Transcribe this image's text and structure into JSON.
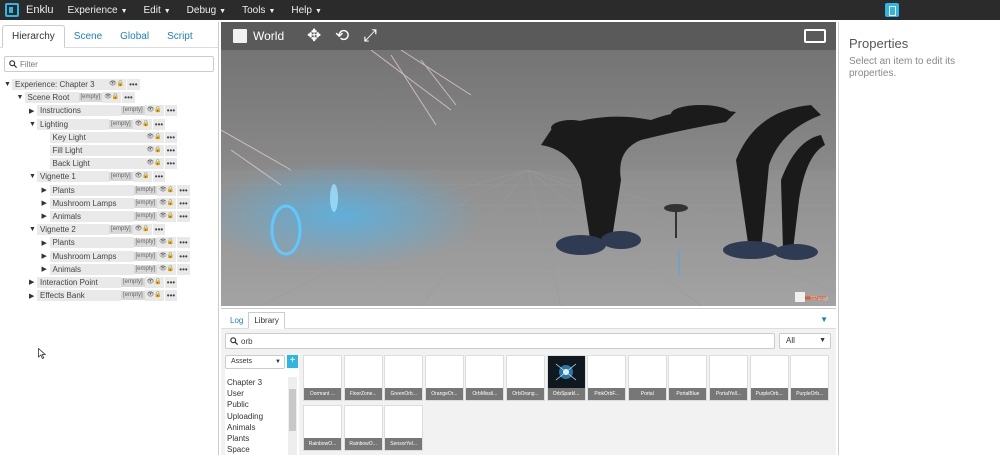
{
  "app": {
    "name": "Enklu"
  },
  "menubar": {
    "items": [
      "Experience",
      "Edit",
      "Debug",
      "Tools",
      "Help"
    ]
  },
  "hierarchy": {
    "tabs": [
      "Hierarchy",
      "Scene",
      "Global",
      "Script"
    ],
    "active_tab": "Hierarchy",
    "filter_placeholder": "Filter",
    "nodes": [
      {
        "label": "Experience: Chapter 3",
        "depth": 0,
        "state": "open",
        "tag": "",
        "eye": true
      },
      {
        "label": "Scene Root",
        "depth": 1,
        "state": "open",
        "tag": "[empty]",
        "eye": true
      },
      {
        "label": "Instructions",
        "depth": 2,
        "state": "closed",
        "tag": "[empty]",
        "eye": true
      },
      {
        "label": "Lighting",
        "depth": 2,
        "state": "open",
        "tag": "[empty]",
        "eye": true
      },
      {
        "label": "Key Light",
        "depth": 3,
        "state": "none",
        "tag": "",
        "eye": true
      },
      {
        "label": "Fill Light",
        "depth": 3,
        "state": "none",
        "tag": "",
        "eye": true
      },
      {
        "label": "Back Light",
        "depth": 3,
        "state": "none",
        "tag": "",
        "eye": true
      },
      {
        "label": "Vignette 1",
        "depth": 2,
        "state": "open",
        "tag": "[empty]",
        "eye": true
      },
      {
        "label": "Plants",
        "depth": 3,
        "state": "closed",
        "tag": "[empty]",
        "eye": true
      },
      {
        "label": "Mushroom Lamps",
        "depth": 3,
        "state": "closed",
        "tag": "[empty]",
        "eye": true
      },
      {
        "label": "Animals",
        "depth": 3,
        "state": "closed",
        "tag": "[empty]",
        "eye": true
      },
      {
        "label": "Vignette 2",
        "depth": 2,
        "state": "open",
        "tag": "[empty]",
        "eye": true
      },
      {
        "label": "Plants",
        "depth": 3,
        "state": "closed",
        "tag": "[empty]",
        "eye": true
      },
      {
        "label": "Mushroom Lamps",
        "depth": 3,
        "state": "closed",
        "tag": "[empty]",
        "eye": true
      },
      {
        "label": "Animals",
        "depth": 3,
        "state": "closed",
        "tag": "[empty]",
        "eye": true
      },
      {
        "label": "Interaction Point",
        "depth": 2,
        "state": "closed",
        "tag": "[empty]",
        "eye": true
      },
      {
        "label": "Effects Bank",
        "depth": 2,
        "state": "closed",
        "tag": "[empty]",
        "eye": true
      }
    ]
  },
  "viewport": {
    "space_label": "World",
    "credit": "©Passp"
  },
  "library": {
    "tabs": [
      "Log",
      "Library"
    ],
    "active_tab": "Library",
    "search_value": "orb",
    "filter_value": "All",
    "source_value": "Assets",
    "categories": [
      "Chapter 3",
      "User",
      "Public",
      "Uploading",
      "Animals",
      "Plants",
      "Space"
    ],
    "assets": [
      {
        "name": "Dormant ...",
        "selected": false
      },
      {
        "name": "FloorZone...",
        "selected": false
      },
      {
        "name": "GreenOrb...",
        "selected": false
      },
      {
        "name": "OrangeOr...",
        "selected": false
      },
      {
        "name": "OrbMissil...",
        "selected": false
      },
      {
        "name": "OrbOrang...",
        "selected": false
      },
      {
        "name": "OrbSparkl...",
        "selected": true
      },
      {
        "name": "PinkOrbF...",
        "selected": false
      },
      {
        "name": "Portal",
        "selected": false
      },
      {
        "name": "PortalBlue",
        "selected": false
      },
      {
        "name": "PortalYell...",
        "selected": false
      },
      {
        "name": "PurpleOrb...",
        "selected": false
      },
      {
        "name": "PurpleOrb...",
        "selected": false
      },
      {
        "name": "RainbowO...",
        "selected": false
      },
      {
        "name": "RainbowO...",
        "selected": false
      },
      {
        "name": "SensorYel...",
        "selected": false
      }
    ]
  },
  "properties": {
    "title": "Properties",
    "message": "Select an item to edit its properties."
  },
  "colors": {
    "accent": "#2fb5e6",
    "menubar": "#2b2b2b",
    "viewport_bg": "#7b7b7b"
  },
  "icons": {
    "hierarchy_row": [
      "eye-icon",
      "lock-icon",
      "more-icon"
    ],
    "toolbar": [
      "move-icon",
      "rotate-icon",
      "scale-icon",
      "fullscreen-icon"
    ]
  }
}
